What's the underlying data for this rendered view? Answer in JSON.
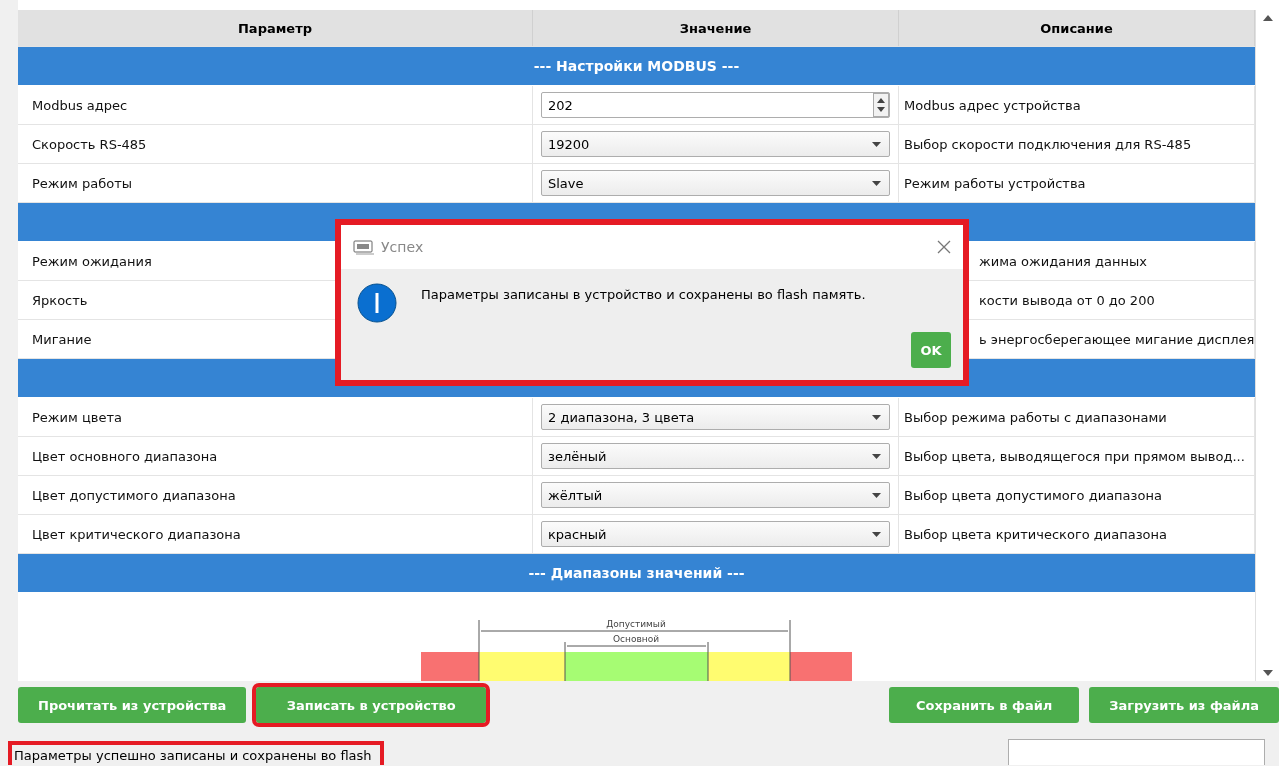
{
  "table": {
    "columns": [
      "Параметр",
      "Значение",
      "Описание"
    ],
    "rows": [
      {
        "kind": "section",
        "title": "--- Настройки MODBUS ---"
      },
      {
        "kind": "spin",
        "name": "Modbus адрес",
        "value": "202",
        "description": "Modbus адрес устройства"
      },
      {
        "kind": "select",
        "name": "Скорость RS-485",
        "value": "19200",
        "description": "Выбор скорости подключения для RS-485"
      },
      {
        "kind": "select",
        "name": "Режим работы",
        "value": "Slave",
        "description": "Режим работы устройства"
      },
      {
        "kind": "section"
      },
      {
        "kind": "covered",
        "name": "Режим ожидания",
        "description": "жима ожидания данных"
      },
      {
        "kind": "covered",
        "name": "Яркость",
        "description": "кости вывода от 0 до 200"
      },
      {
        "kind": "covered",
        "name": "Мигание",
        "description": "ь энергосберегающее мигание дисплея"
      },
      {
        "kind": "section"
      },
      {
        "kind": "select",
        "name": "Режим цвета",
        "value": "2 диапазона, 3 цвета",
        "description": "Выбор режима работы с диапазонами"
      },
      {
        "kind": "select",
        "name": "Цвет основного диапазона",
        "value": "зелёный",
        "description": "Выбор цвета, выводящегося при прямом вывод..."
      },
      {
        "kind": "select",
        "name": "Цвет допустимого диапазона",
        "value": "жёлтый",
        "description": "Выбор цвета допустимого диапазона"
      },
      {
        "kind": "select",
        "name": "Цвет критического диапазона",
        "value": "красный",
        "description": "Выбор цвета критического диапазона"
      },
      {
        "kind": "section",
        "title": "--- Диапазоны значений ---"
      },
      {
        "kind": "diagram",
        "outer_label": "Допустимый",
        "inner_label": "Основной"
      }
    ]
  },
  "buttons_left": [
    {
      "label": "Прочитать из устройства",
      "highlighted": false
    },
    {
      "label": "Записать в устройство",
      "highlighted": true
    }
  ],
  "buttons_right": [
    {
      "label": "Сохранить в файл",
      "highlighted": false
    },
    {
      "label": "Загрузить из файла",
      "highlighted": false
    }
  ],
  "status": {
    "text": "Параметры успешно записаны и сохранены во flash",
    "highlighted": true
  },
  "dialog": {
    "title": "Успех",
    "message": "Параметры записаны в устройство и сохранены во flash память.",
    "button": "OK",
    "highlighted": true
  }
}
